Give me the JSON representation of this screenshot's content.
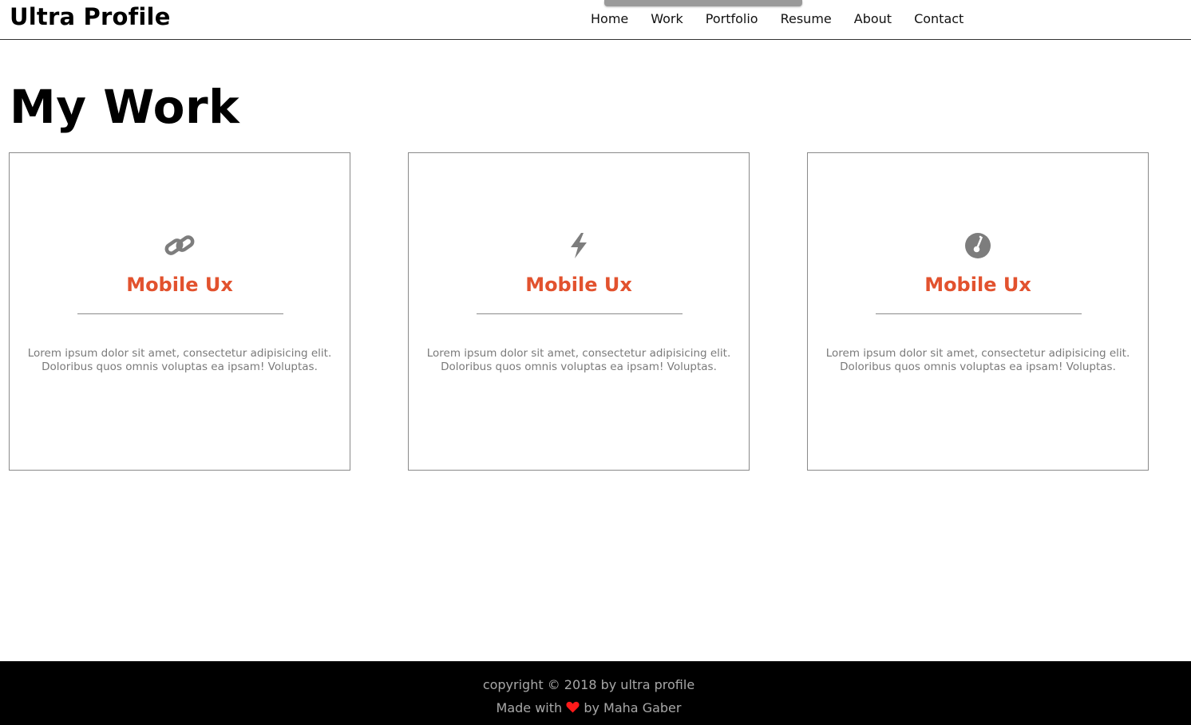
{
  "header": {
    "brand": "Ultra Profile",
    "nav": [
      "Home",
      "Work",
      "Portfolio",
      "Resume",
      "About",
      "Contact"
    ]
  },
  "main": {
    "title": "My Work",
    "cards": [
      {
        "icon": "link-icon",
        "title": "Mobile Ux",
        "text_line1": "Lorem ipsum dolor sit amet, consectetur adipisicing elit.",
        "text_line2": "Doloribus quos omnis voluptas ea ipsam! Voluptas."
      },
      {
        "icon": "bolt-icon",
        "title": "Mobile Ux",
        "text_line1": "Lorem ipsum dolor sit amet, consectetur adipisicing elit.",
        "text_line2": "Doloribus quos omnis voluptas ea ipsam! Voluptas."
      },
      {
        "icon": "thermometer-icon",
        "title": "Mobile Ux",
        "text_line1": "Lorem ipsum dolor sit amet, consectetur adipisicing elit.",
        "text_line2": "Doloribus quos omnis voluptas ea ipsam! Voluptas."
      }
    ]
  },
  "footer": {
    "copyright": "copyright © 2018 by ultra profile",
    "made_with_prefix": "Made with",
    "made_with_suffix": "by Maha Gaber",
    "heart_icon": "heart-icon"
  },
  "colors": {
    "accent": "#e2522e",
    "text_muted": "#7a7a7a",
    "footer_bg": "#000000",
    "heart": "#ff1a1a"
  }
}
